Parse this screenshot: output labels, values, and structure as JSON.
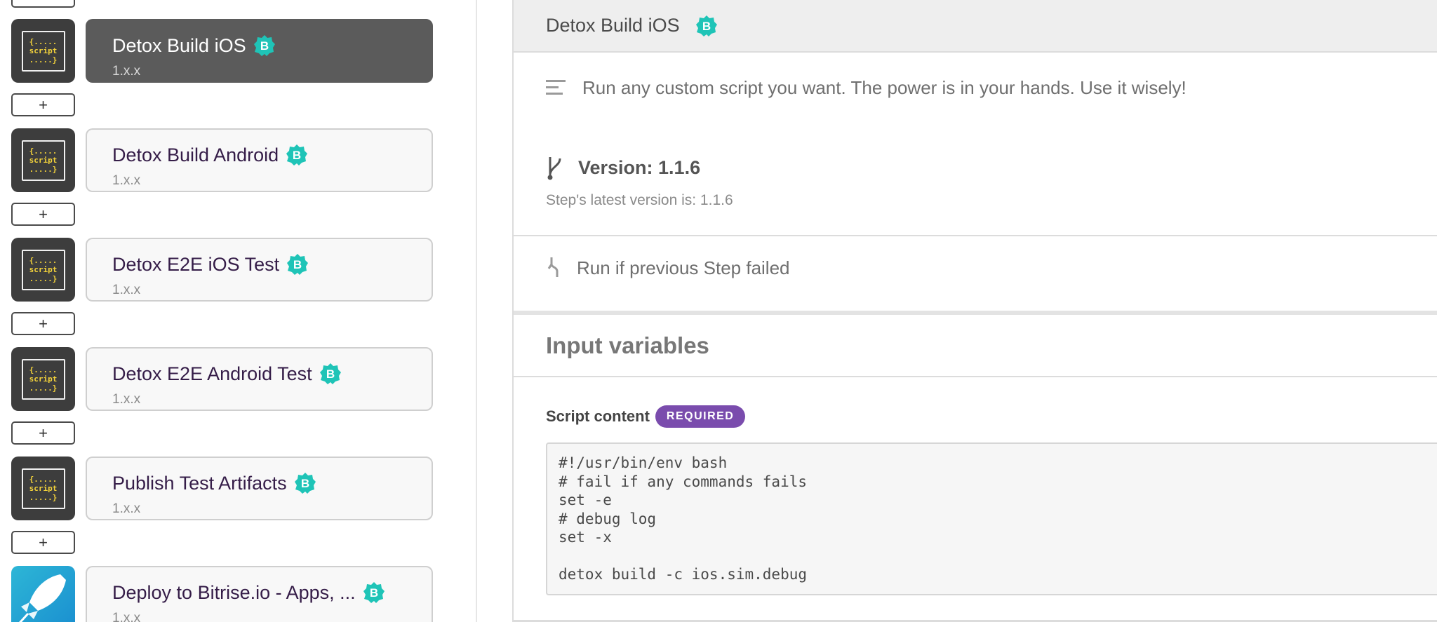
{
  "steps": [
    {
      "title": "Detox Build iOS",
      "version": "1.x.x",
      "selected": true,
      "icon": "script-icon"
    },
    {
      "title": "Detox Build Android",
      "version": "1.x.x",
      "selected": false,
      "icon": "script-icon"
    },
    {
      "title": "Detox E2E iOS Test",
      "version": "1.x.x",
      "selected": false,
      "icon": "script-icon"
    },
    {
      "title": "Detox E2E Android Test",
      "version": "1.x.x",
      "selected": false,
      "icon": "script-icon"
    },
    {
      "title": "Publish Test Artifacts",
      "version": "1.x.x",
      "selected": false,
      "icon": "script-icon"
    },
    {
      "title": "Deploy to Bitrise.io - Apps, ...",
      "version": "1.x.x",
      "selected": false,
      "icon": "deploy-rocket-icon"
    }
  ],
  "script_glyph": {
    "line1": "{.....",
    "line2": "script",
    "line3": ".....}"
  },
  "add_label": "+",
  "badge_letter": "B",
  "detail": {
    "header_title": "Detox Build iOS",
    "description": "Run any custom script you want. The power is in your hands. Use it wisely!",
    "version_label": "Version: 1.1.6",
    "latest_version": "Step's latest version is: 1.1.6",
    "run_if": "Run if previous Step failed",
    "input_variables_title": "Input variables",
    "script_content_label": "Script content",
    "required_label": "REQUIRED",
    "script_code": "#!/usr/bin/env bash\n# fail if any commands fails\nset -e\n# debug log\nset -x\n\ndetox build -c ios.sim.debug"
  },
  "colors": {
    "badge": "#1fc4b7",
    "selected_card": "#5b5b5b",
    "required_pill": "#7a4cad",
    "title_purple": "#351d48"
  }
}
